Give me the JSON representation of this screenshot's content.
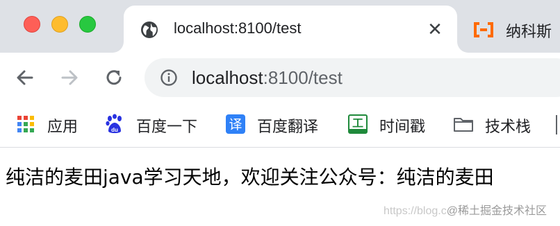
{
  "window": {
    "traffic_lights": {
      "close": "#fe5f57",
      "minimize": "#febc2e",
      "maximize": "#28c840"
    }
  },
  "tabs": {
    "active": {
      "title": "localhost:8100/test",
      "favicon": "globe-icon",
      "close_label": "✕"
    },
    "inactive": {
      "title": "纳科斯",
      "favicon": "aliyun-icon",
      "favicon_color": "#ff6a00"
    }
  },
  "toolbar": {
    "back": "arrow-left-icon",
    "forward": "arrow-right-icon",
    "reload": "reload-icon",
    "omnibox": {
      "info_icon": "info-icon",
      "url_host": "localhost",
      "url_rest": ":8100/test"
    }
  },
  "bookmarks": [
    {
      "label": "应用",
      "icon": "apps-grid-icon"
    },
    {
      "label": "百度一下",
      "icon": "baidu-paw-icon"
    },
    {
      "label": "百度翻译",
      "icon": "translate-icon",
      "icon_text": "译"
    },
    {
      "label": "时间戳",
      "icon": "web-tool-icon",
      "icon_text": "工"
    },
    {
      "label": "技术栈",
      "icon": "folder-icon"
    }
  ],
  "page": {
    "content_text": "纯洁的麦田java学习天地，欢迎关注公众号：纯洁的麦田",
    "watermark_url": "https://blog.c",
    "watermark_brand": "@稀土掘金技术社区"
  }
}
